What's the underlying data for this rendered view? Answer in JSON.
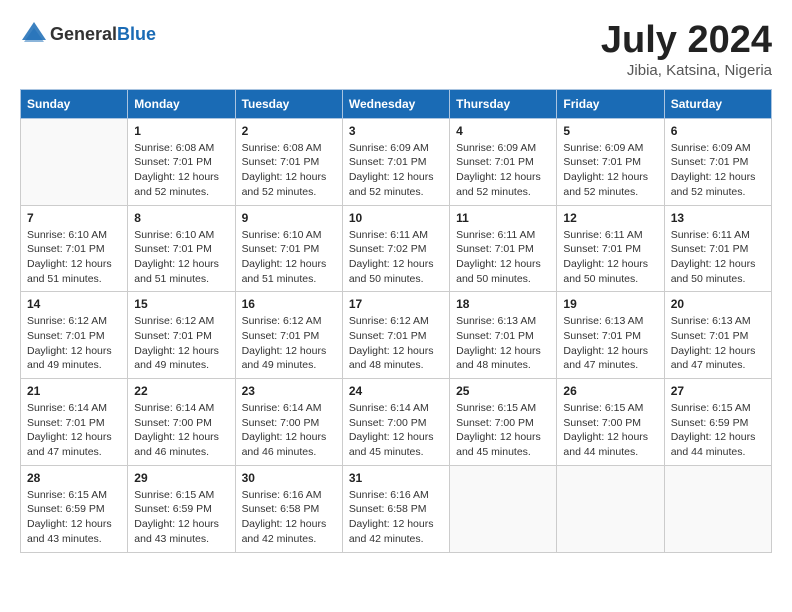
{
  "logo": {
    "general": "General",
    "blue": "Blue"
  },
  "title": "July 2024",
  "location": "Jibia, Katsina, Nigeria",
  "days": [
    "Sunday",
    "Monday",
    "Tuesday",
    "Wednesday",
    "Thursday",
    "Friday",
    "Saturday"
  ],
  "weeks": [
    [
      {
        "date": "",
        "sunrise": "",
        "sunset": "",
        "daylight": ""
      },
      {
        "date": "1",
        "sunrise": "Sunrise: 6:08 AM",
        "sunset": "Sunset: 7:01 PM",
        "daylight": "Daylight: 12 hours and 52 minutes."
      },
      {
        "date": "2",
        "sunrise": "Sunrise: 6:08 AM",
        "sunset": "Sunset: 7:01 PM",
        "daylight": "Daylight: 12 hours and 52 minutes."
      },
      {
        "date": "3",
        "sunrise": "Sunrise: 6:09 AM",
        "sunset": "Sunset: 7:01 PM",
        "daylight": "Daylight: 12 hours and 52 minutes."
      },
      {
        "date": "4",
        "sunrise": "Sunrise: 6:09 AM",
        "sunset": "Sunset: 7:01 PM",
        "daylight": "Daylight: 12 hours and 52 minutes."
      },
      {
        "date": "5",
        "sunrise": "Sunrise: 6:09 AM",
        "sunset": "Sunset: 7:01 PM",
        "daylight": "Daylight: 12 hours and 52 minutes."
      },
      {
        "date": "6",
        "sunrise": "Sunrise: 6:09 AM",
        "sunset": "Sunset: 7:01 PM",
        "daylight": "Daylight: 12 hours and 52 minutes."
      }
    ],
    [
      {
        "date": "7",
        "sunrise": "Sunrise: 6:10 AM",
        "sunset": "Sunset: 7:01 PM",
        "daylight": "Daylight: 12 hours and 51 minutes."
      },
      {
        "date": "8",
        "sunrise": "Sunrise: 6:10 AM",
        "sunset": "Sunset: 7:01 PM",
        "daylight": "Daylight: 12 hours and 51 minutes."
      },
      {
        "date": "9",
        "sunrise": "Sunrise: 6:10 AM",
        "sunset": "Sunset: 7:01 PM",
        "daylight": "Daylight: 12 hours and 51 minutes."
      },
      {
        "date": "10",
        "sunrise": "Sunrise: 6:11 AM",
        "sunset": "Sunset: 7:02 PM",
        "daylight": "Daylight: 12 hours and 50 minutes."
      },
      {
        "date": "11",
        "sunrise": "Sunrise: 6:11 AM",
        "sunset": "Sunset: 7:01 PM",
        "daylight": "Daylight: 12 hours and 50 minutes."
      },
      {
        "date": "12",
        "sunrise": "Sunrise: 6:11 AM",
        "sunset": "Sunset: 7:01 PM",
        "daylight": "Daylight: 12 hours and 50 minutes."
      },
      {
        "date": "13",
        "sunrise": "Sunrise: 6:11 AM",
        "sunset": "Sunset: 7:01 PM",
        "daylight": "Daylight: 12 hours and 50 minutes."
      }
    ],
    [
      {
        "date": "14",
        "sunrise": "Sunrise: 6:12 AM",
        "sunset": "Sunset: 7:01 PM",
        "daylight": "Daylight: 12 hours and 49 minutes."
      },
      {
        "date": "15",
        "sunrise": "Sunrise: 6:12 AM",
        "sunset": "Sunset: 7:01 PM",
        "daylight": "Daylight: 12 hours and 49 minutes."
      },
      {
        "date": "16",
        "sunrise": "Sunrise: 6:12 AM",
        "sunset": "Sunset: 7:01 PM",
        "daylight": "Daylight: 12 hours and 49 minutes."
      },
      {
        "date": "17",
        "sunrise": "Sunrise: 6:12 AM",
        "sunset": "Sunset: 7:01 PM",
        "daylight": "Daylight: 12 hours and 48 minutes."
      },
      {
        "date": "18",
        "sunrise": "Sunrise: 6:13 AM",
        "sunset": "Sunset: 7:01 PM",
        "daylight": "Daylight: 12 hours and 48 minutes."
      },
      {
        "date": "19",
        "sunrise": "Sunrise: 6:13 AM",
        "sunset": "Sunset: 7:01 PM",
        "daylight": "Daylight: 12 hours and 47 minutes."
      },
      {
        "date": "20",
        "sunrise": "Sunrise: 6:13 AM",
        "sunset": "Sunset: 7:01 PM",
        "daylight": "Daylight: 12 hours and 47 minutes."
      }
    ],
    [
      {
        "date": "21",
        "sunrise": "Sunrise: 6:14 AM",
        "sunset": "Sunset: 7:01 PM",
        "daylight": "Daylight: 12 hours and 47 minutes."
      },
      {
        "date": "22",
        "sunrise": "Sunrise: 6:14 AM",
        "sunset": "Sunset: 7:00 PM",
        "daylight": "Daylight: 12 hours and 46 minutes."
      },
      {
        "date": "23",
        "sunrise": "Sunrise: 6:14 AM",
        "sunset": "Sunset: 7:00 PM",
        "daylight": "Daylight: 12 hours and 46 minutes."
      },
      {
        "date": "24",
        "sunrise": "Sunrise: 6:14 AM",
        "sunset": "Sunset: 7:00 PM",
        "daylight": "Daylight: 12 hours and 45 minutes."
      },
      {
        "date": "25",
        "sunrise": "Sunrise: 6:15 AM",
        "sunset": "Sunset: 7:00 PM",
        "daylight": "Daylight: 12 hours and 45 minutes."
      },
      {
        "date": "26",
        "sunrise": "Sunrise: 6:15 AM",
        "sunset": "Sunset: 7:00 PM",
        "daylight": "Daylight: 12 hours and 44 minutes."
      },
      {
        "date": "27",
        "sunrise": "Sunrise: 6:15 AM",
        "sunset": "Sunset: 6:59 PM",
        "daylight": "Daylight: 12 hours and 44 minutes."
      }
    ],
    [
      {
        "date": "28",
        "sunrise": "Sunrise: 6:15 AM",
        "sunset": "Sunset: 6:59 PM",
        "daylight": "Daylight: 12 hours and 43 minutes."
      },
      {
        "date": "29",
        "sunrise": "Sunrise: 6:15 AM",
        "sunset": "Sunset: 6:59 PM",
        "daylight": "Daylight: 12 hours and 43 minutes."
      },
      {
        "date": "30",
        "sunrise": "Sunrise: 6:16 AM",
        "sunset": "Sunset: 6:58 PM",
        "daylight": "Daylight: 12 hours and 42 minutes."
      },
      {
        "date": "31",
        "sunrise": "Sunrise: 6:16 AM",
        "sunset": "Sunset: 6:58 PM",
        "daylight": "Daylight: 12 hours and 42 minutes."
      },
      {
        "date": "",
        "sunrise": "",
        "sunset": "",
        "daylight": ""
      },
      {
        "date": "",
        "sunrise": "",
        "sunset": "",
        "daylight": ""
      },
      {
        "date": "",
        "sunrise": "",
        "sunset": "",
        "daylight": ""
      }
    ]
  ]
}
